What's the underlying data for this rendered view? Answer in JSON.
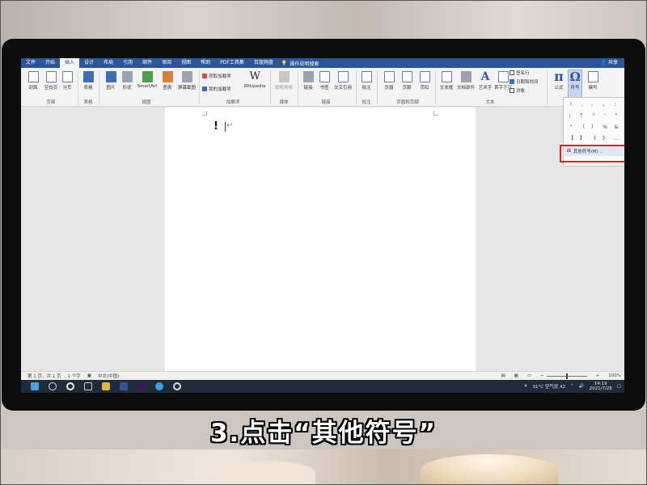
{
  "menubar": {
    "tabs": [
      "文件",
      "开始",
      "插入",
      "设计",
      "布局",
      "引用",
      "邮件",
      "审阅",
      "视图",
      "帮助",
      "PDF工具集",
      "百度网盘"
    ],
    "active_tab": "插入",
    "tell_me": "操作说明搜索",
    "share": "共享"
  },
  "ribbon": {
    "buttons": {
      "cover": "封面",
      "blank_page": "空白页",
      "page_break": "分页",
      "table": "表格",
      "picture": "图片",
      "shapes": "形状",
      "smartart": "SmartArt",
      "chart": "图表",
      "screenshot": "屏幕截图",
      "get_addins": "获取加载项",
      "my_addins": "我的加载项",
      "wikipedia": "Wikipedia",
      "online_video": "联机视频",
      "link": "链接",
      "bookmark": "书签",
      "cross_ref": "交叉引用",
      "comment": "批注",
      "header": "页眉",
      "footer": "页脚",
      "page_number": "页码",
      "textbox": "文本框",
      "quick_parts": "文档部件",
      "wordart": "艺术字",
      "dropcap": "首字下沉",
      "signature": "签名行",
      "datetime": "日期和时间",
      "object": "对象",
      "equation": "公式",
      "symbol": "符号",
      "number": "编号"
    },
    "groups": {
      "pages": "页面",
      "tables": "表格",
      "illustrations": "插图",
      "addins": "加载项",
      "media": "媒体",
      "links": "链接",
      "comments": "批注",
      "header_footer": "页眉和页脚",
      "text": "文本"
    }
  },
  "document": {
    "content": "!"
  },
  "symbols": {
    "grid": [
      "!",
      ",",
      "、",
      "。",
      "：",
      "；",
      "？",
      "\"",
      "'",
      "“",
      "”",
      "（",
      "）",
      "%",
      "&",
      "【",
      "】",
      "《",
      "》",
      "…"
    ],
    "more_label": "其他符号(M)..."
  },
  "statusbar": {
    "page": "第 1 页，共 1 页",
    "words": "1 个字",
    "language": "中文(中国)",
    "zoom": "100%"
  },
  "taskbar": {
    "weather": "31°C 空气优 42",
    "time": "14:19",
    "date": "2021/7/28"
  },
  "caption": "3.点击“其他符号”",
  "colors": {
    "word_blue": "#2b579a",
    "highlight_red": "#e02020",
    "taskbar": "#1f2d3a"
  }
}
